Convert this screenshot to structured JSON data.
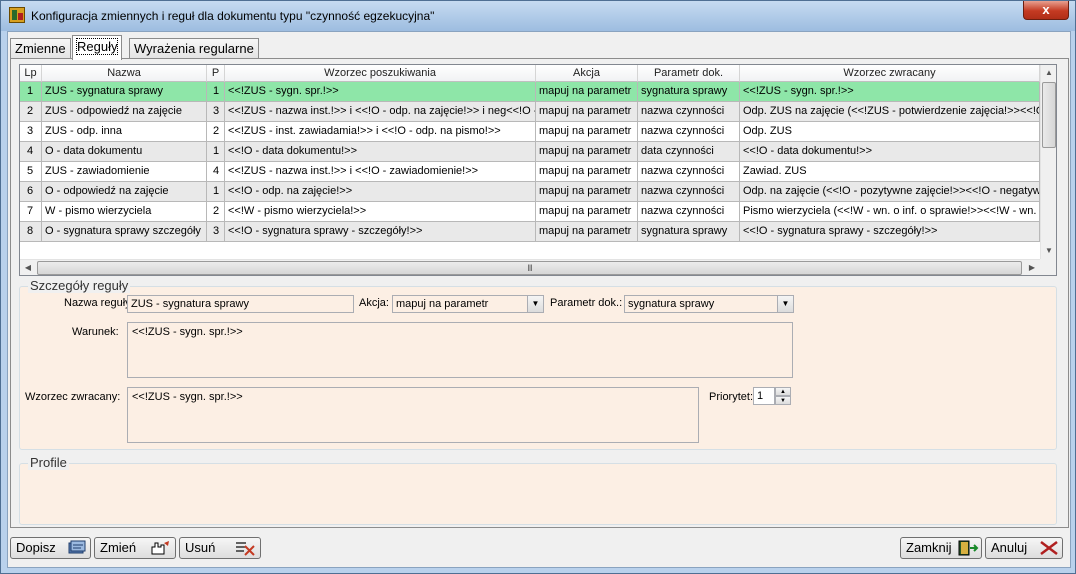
{
  "window": {
    "title": "Konfiguracja zmiennych i reguł dla dokumentu typu \"czynność egzekucyjna\"",
    "close_glyph": "x"
  },
  "tabs": [
    {
      "label": "Zmienne",
      "active": false
    },
    {
      "label": "Reguły",
      "active": true
    },
    {
      "label": "Wyrażenia regularne",
      "active": false
    }
  ],
  "grid": {
    "columns": [
      "Lp",
      "Nazwa",
      "P",
      "Wzorzec poszukiwania",
      "Akcja",
      "Parametr dok.",
      "Wzorzec zwracany"
    ],
    "rows": [
      {
        "lp": "1",
        "nazwa": "ZUS - sygnatura sprawy",
        "p": "1",
        "wzorzec": "<<!ZUS - sygn. spr.!>>",
        "akcja": "mapuj na parametr",
        "parametr": "sygnatura sprawy",
        "zwracany": "<<!ZUS - sygn. spr.!>>"
      },
      {
        "lp": "2",
        "nazwa": "ZUS - odpowiedź na zajęcie",
        "p": "3",
        "wzorzec": "<<!ZUS - nazwa inst.!>>  i <<!O - odp. na zajęcie!>> i neg<<!O -",
        "akcja": "mapuj na parametr",
        "parametr": "nazwa czynności",
        "zwracany": "Odp. ZUS na zajęcie (<<!ZUS - potwierdzenie zajęcia!>><<!O -"
      },
      {
        "lp": "3",
        "nazwa": "ZUS - odp. inna",
        "p": "2",
        "wzorzec": "<<!ZUS - inst. zawiadamia!>> i <<!O - odp. na pismo!>>",
        "akcja": "mapuj na parametr",
        "parametr": "nazwa czynności",
        "zwracany": "Odp. ZUS"
      },
      {
        "lp": "4",
        "nazwa": "O - data dokumentu",
        "p": "1",
        "wzorzec": "<<!O - data dokumentu!>>",
        "akcja": "mapuj na parametr",
        "parametr": "data czynności",
        "zwracany": " <<!O - data dokumentu!>>"
      },
      {
        "lp": "5",
        "nazwa": "ZUS - zawiadomienie",
        "p": "4",
        "wzorzec": "<<!ZUS - nazwa inst.!>>  i  <<!O - zawiadomienie!>>",
        "akcja": "mapuj na parametr",
        "parametr": "nazwa czynności",
        "zwracany": "Zawiad. ZUS"
      },
      {
        "lp": "6",
        "nazwa": "O - odpowiedź na zajęcie",
        "p": "1",
        "wzorzec": "<<!O - odp. na zajęcie!>>",
        "akcja": "mapuj na parametr",
        "parametr": "nazwa czynności",
        "zwracany": "Odp. na zajęcie (<<!O - pozytywne zajęcie!>><<!O - negatywne"
      },
      {
        "lp": "7",
        "nazwa": "W - pismo wierzyciela",
        "p": "2",
        "wzorzec": "<<!W - pismo wierzyciela!>>",
        "akcja": "mapuj na parametr",
        "parametr": "nazwa czynności",
        "zwracany": "Pismo wierzyciela (<<!W - wn. o inf. o sprawie!>><<!W - wn. o z"
      },
      {
        "lp": "8",
        "nazwa": "O - sygnatura sprawy szczegóły",
        "p": "3",
        "wzorzec": "<<!O - sygnatura sprawy - szczegóły!>>",
        "akcja": "mapuj na parametr",
        "parametr": "sygnatura sprawy",
        "zwracany": " <<!O - sygnatura sprawy - szczegóły!>>"
      }
    ],
    "scroll_grip": "III"
  },
  "details": {
    "group_title": "Szczegóły reguły",
    "rule_name_label": "Nazwa reguły:",
    "rule_name_value": "ZUS - sygnatura sprawy",
    "action_label": "Akcja:",
    "action_value": "mapuj na parametr",
    "param_label": "Parametr dok.:",
    "param_value": "sygnatura sprawy",
    "condition_label": "Warunek:",
    "condition_value": "<<!ZUS - sygn. spr.!>>",
    "return_label": "Wzorzec zwracany:",
    "return_value": "<<!ZUS - sygn. spr.!>>",
    "priority_label": "Priorytet:",
    "priority_value": "1"
  },
  "profiles": {
    "group_title": "Profile"
  },
  "buttons": {
    "add": "Dopisz",
    "edit": "Zmień",
    "delete": "Usuń",
    "close": "Zamknij",
    "cancel": "Anuluj"
  },
  "colors": {
    "selected_row": "#8ee6a8",
    "field_background": "#fcefe4",
    "accent_red": "#c43a22"
  }
}
